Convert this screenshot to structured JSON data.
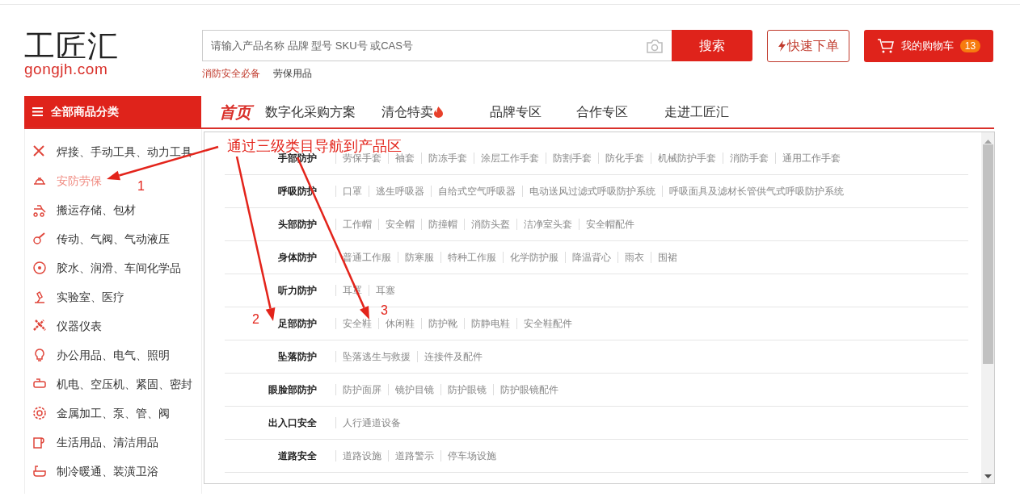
{
  "logo": {
    "name": "工匠汇",
    "domain": "gongjh.com"
  },
  "search": {
    "placeholder": "请输入产品名称 品牌 型号 SKU号 或CAS号",
    "button": "搜索"
  },
  "hot_keywords": [
    {
      "text": "消防安全必备",
      "highlighted": true
    },
    {
      "text": "劳保用品",
      "highlighted": false
    }
  ],
  "quick_order": {
    "label": "快速下单"
  },
  "cart": {
    "label": "我的购物车",
    "count": "13"
  },
  "category_header": "全部商品分类",
  "nav": [
    {
      "label": "首页",
      "selected": true,
      "hot": false
    },
    {
      "label": "数字化采购方案",
      "selected": false,
      "hot": false
    },
    {
      "label": "清仓特卖",
      "selected": false,
      "hot": true
    },
    {
      "label": "品牌专区",
      "selected": false,
      "hot": false
    },
    {
      "label": "合作专区",
      "selected": false,
      "hot": false
    },
    {
      "label": "走进工匠汇",
      "selected": false,
      "hot": false
    }
  ],
  "sidebar": {
    "items": [
      {
        "label": "焊接、手动工具、动力工具",
        "selected": false
      },
      {
        "label": "安防劳保",
        "selected": true
      },
      {
        "label": "搬运存储、包材",
        "selected": false
      },
      {
        "label": "传动、气阀、气动液压",
        "selected": false
      },
      {
        "label": "胶水、润滑、车间化学品",
        "selected": false
      },
      {
        "label": "实验室、医疗",
        "selected": false
      },
      {
        "label": "仪器仪表",
        "selected": false
      },
      {
        "label": "办公用品、电气、照明",
        "selected": false
      },
      {
        "label": "机电、空压机、紧固、密封",
        "selected": false
      },
      {
        "label": "金属加工、泵、管、阀",
        "selected": false
      },
      {
        "label": "生活用品、清洁用品",
        "selected": false
      },
      {
        "label": "制冷暖通、装潢卫浴",
        "selected": false
      }
    ]
  },
  "dropdown": {
    "rows": [
      {
        "label": "手部防护",
        "links": [
          "劳保手套",
          "袖套",
          "防冻手套",
          "涂层工作手套",
          "防割手套",
          "防化手套",
          "机械防护手套",
          "消防手套",
          "通用工作手套"
        ]
      },
      {
        "label": "呼吸防护",
        "links": [
          "口罩",
          "逃生呼吸器",
          "自给式空气呼吸器",
          "电动送风过滤式呼吸防护系统",
          "呼吸面具及滤材长管供气式呼吸防护系统"
        ]
      },
      {
        "label": "头部防护",
        "links": [
          "工作帽",
          "安全帽",
          "防撞帽",
          "消防头盔",
          "洁净室头套",
          "安全帽配件"
        ]
      },
      {
        "label": "身体防护",
        "links": [
          "普通工作服",
          "防寒服",
          "特种工作服",
          "化学防护服",
          "降温背心",
          "雨衣",
          "围裙"
        ]
      },
      {
        "label": "听力防护",
        "links": [
          "耳罩",
          "耳塞"
        ]
      },
      {
        "label": "足部防护",
        "links": [
          "安全鞋",
          "休闲鞋",
          "防护靴",
          "防静电鞋",
          "安全鞋配件"
        ]
      },
      {
        "label": "坠落防护",
        "links": [
          "坠落逃生与救援",
          "连接件及配件"
        ]
      },
      {
        "label": "眼脸部防护",
        "links": [
          "防护面屏",
          "镜护目镜",
          "防护眼镜",
          "防护眼镜配件"
        ]
      },
      {
        "label": "出入口安全",
        "links": [
          "人行通道设备"
        ]
      },
      {
        "label": "道路安全",
        "links": [
          "道路设施",
          "道路警示",
          "停车场设施"
        ]
      }
    ]
  },
  "annotation": {
    "title": "通过三级类目导航到产品区",
    "markers": [
      "1",
      "2",
      "3"
    ]
  }
}
